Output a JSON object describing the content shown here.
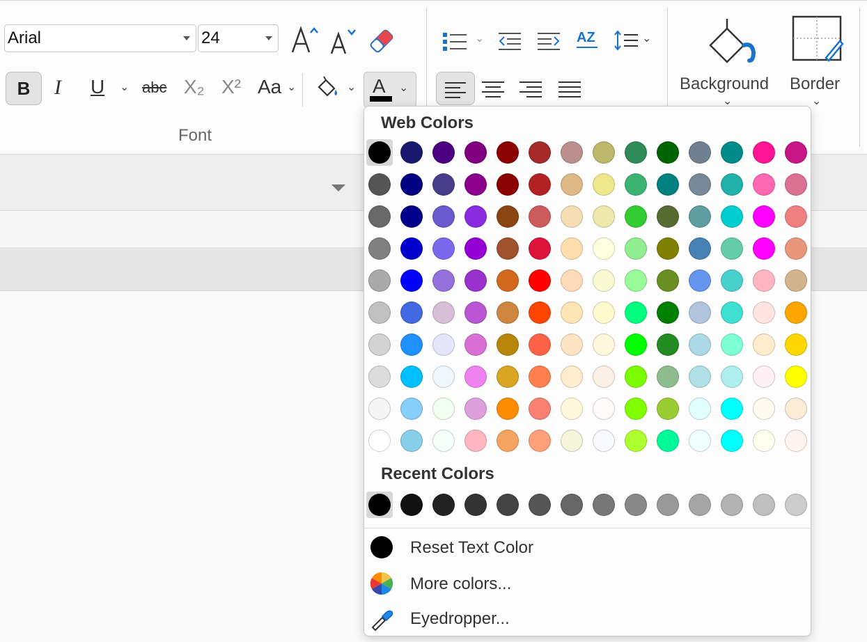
{
  "ribbon": {
    "font_name": "Arial",
    "font_size": "24",
    "bold_label": "B",
    "italic_label": "I",
    "underline_label": "U",
    "strike_label": "abc",
    "subscript_label": "X₂",
    "superscript_label": "X²",
    "change_case_label": "Aa",
    "font_color_label": "A",
    "font_group_label": "Font",
    "sort_label": "AZ",
    "background_label": "Background",
    "border_label": "Border",
    "font_color_current": "#000000"
  },
  "popup": {
    "web_colors_title": "Web Colors",
    "recent_colors_title": "Recent Colors",
    "selected_color": "#000000",
    "web_colors": [
      [
        "#000000",
        "#191970",
        "#4B0082",
        "#800080",
        "#8B0000",
        "#A52A2A",
        "#BC8F8F",
        "#BDB76B",
        "#2E8B57",
        "#006400",
        "#708090",
        "#008B8B",
        "#FF1493",
        "#C71585"
      ],
      [
        "#555555",
        "#000080",
        "#483D8B",
        "#8B008B",
        "#8B0000",
        "#B22222",
        "#DEB887",
        "#F0E68C",
        "#3CB371",
        "#008080",
        "#778899",
        "#20B2AA",
        "#FF69B4",
        "#DB7093"
      ],
      [
        "#696969",
        "#00008B",
        "#6A5ACD",
        "#8A2BE2",
        "#8B4513",
        "#CD5C5C",
        "#F5DEB3",
        "#EEE8AA",
        "#32CD32",
        "#556B2F",
        "#5F9EA0",
        "#00CED1",
        "#FF00FF",
        "#F08080"
      ],
      [
        "#808080",
        "#0000CD",
        "#7B68EE",
        "#9400D3",
        "#A0522D",
        "#DC143C",
        "#FFDEAD",
        "#FFFFE0",
        "#90EE90",
        "#808000",
        "#4682B4",
        "#66CDAA",
        "#FF00FF",
        "#E9967A"
      ],
      [
        "#A9A9A9",
        "#0000FF",
        "#9370DB",
        "#9932CC",
        "#D2691E",
        "#FF0000",
        "#FFDAB9",
        "#FAFAD2",
        "#98FB98",
        "#6B8E23",
        "#6495ED",
        "#48D1CC",
        "#FFB6C1",
        "#D2B48C"
      ],
      [
        "#C0C0C0",
        "#4169E1",
        "#D8BFD8",
        "#BA55D3",
        "#CD853F",
        "#FF4500",
        "#FFE4B5",
        "#FFFACD",
        "#00FF7F",
        "#008000",
        "#B0C4DE",
        "#40E0D0",
        "#FFE4E1",
        "#FFA500"
      ],
      [
        "#D3D3D3",
        "#1E90FF",
        "#E6E6FA",
        "#DA70D6",
        "#B8860B",
        "#FF6347",
        "#FFE4C4",
        "#FFF8DC",
        "#00FF00",
        "#228B22",
        "#ADD8E6",
        "#7FFFD4",
        "#FFEBCD",
        "#FFD700"
      ],
      [
        "#DCDCDC",
        "#00BFFF",
        "#F0F8FF",
        "#EE82EE",
        "#DAA520",
        "#FF7F50",
        "#FFEBCD",
        "#FAF0E6",
        "#7CFC00",
        "#8FBC8F",
        "#B0E0E6",
        "#AFEEEE",
        "#FFF0F5",
        "#FFFF00"
      ],
      [
        "#F5F5F5",
        "#87CEFA",
        "#F0FFF0",
        "#DDA0DD",
        "#FF8C00",
        "#FA8072",
        "#FFF8DC",
        "#FFFAFA",
        "#7FFF00",
        "#9ACD32",
        "#E0FFFF",
        "#00FFFF",
        "#FFFAF0",
        "#FAEBD7"
      ],
      [
        "#FFFFFF",
        "#87CEEB",
        "#F5FFFA",
        "#FFB6C1",
        "#F4A460",
        "#FFA07A",
        "#F5F5DC",
        "#F8F8FF",
        "#ADFF2F",
        "#00FA9A",
        "#F0FFFF",
        "#00FFFF",
        "#FFFFF0",
        "#FFF5EE"
      ]
    ],
    "recent_colors": [
      "#000000",
      "#111111",
      "#222222",
      "#333333",
      "#444444",
      "#555555",
      "#666666",
      "#777777",
      "#888888",
      "#999999",
      "#A5A5A5",
      "#B2B2B2",
      "#BFBFBF",
      "#CCCCCC"
    ],
    "menu": [
      {
        "label": "Reset Text Color",
        "icon": "black-circle-icon"
      },
      {
        "label": "More colors...",
        "icon": "color-wheel-icon"
      },
      {
        "label": "Eyedropper...",
        "icon": "eyedropper-icon"
      }
    ]
  }
}
